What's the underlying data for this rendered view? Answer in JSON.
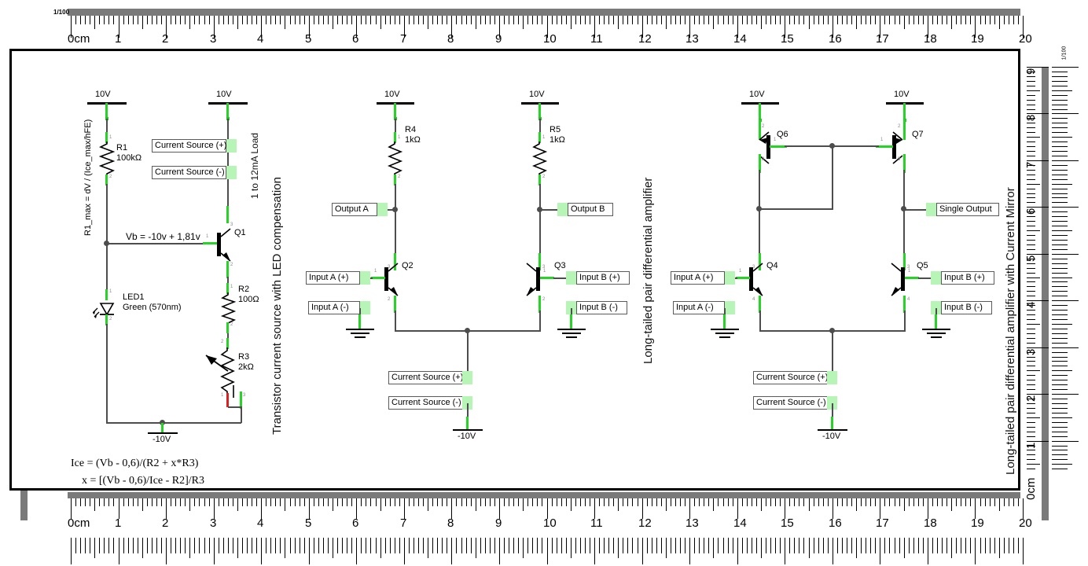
{
  "ruler": {
    "scale_label": "1/100",
    "unit_label": "0cm",
    "h_ticks": [
      "0cm",
      "1",
      "2",
      "3",
      "4",
      "5",
      "6",
      "7",
      "8",
      "9",
      "10",
      "11",
      "12",
      "13",
      "14",
      "15",
      "16",
      "17",
      "18",
      "19",
      "20"
    ],
    "v_ticks": [
      "9",
      "8",
      "7",
      "6",
      "5",
      "4",
      "3",
      "2",
      "1",
      "0cm"
    ]
  },
  "circuits": [
    {
      "title": "Transistor current source with LED compensation",
      "rails": {
        "top_left": "10V",
        "top_right": "10V",
        "bottom": "-10V"
      },
      "components": [
        {
          "ref": "R1",
          "value": "100kΩ"
        },
        {
          "ref": "R2",
          "value": "100Ω"
        },
        {
          "ref": "R3",
          "value": "2kΩ"
        },
        {
          "ref": "LED1",
          "value": "Green (570nm)"
        },
        {
          "ref": "Q1",
          "value": ""
        }
      ],
      "flags": [
        {
          "label": "Current Source (+)"
        },
        {
          "label": "Current Source (-)"
        }
      ],
      "annotations": {
        "r1_max": "R1_max = dV / (Ice_max/hFE)",
        "vb": "Vb = -10v + 1,81v",
        "load": "1 to 12mA Load"
      },
      "formulas": [
        "Ice = (Vb - 0,6)/(R2 + x*R3)",
        "x = [(Vb - 0,6)/Ice - R2]/R3"
      ]
    },
    {
      "title": "Long-tailed pair differential amplifier",
      "rails": {
        "top_left": "10V",
        "top_right": "10V",
        "bottom": "-10V"
      },
      "components": [
        {
          "ref": "R4",
          "value": "1kΩ"
        },
        {
          "ref": "R5",
          "value": "1kΩ"
        },
        {
          "ref": "Q2",
          "value": ""
        },
        {
          "ref": "Q3",
          "value": ""
        }
      ],
      "flags": [
        {
          "label": "Output A"
        },
        {
          "label": "Output B"
        },
        {
          "label": "Input A (+)"
        },
        {
          "label": "Input A (-)"
        },
        {
          "label": "Input B (+)"
        },
        {
          "label": "Input B (-)"
        },
        {
          "label": "Current Source (+)"
        },
        {
          "label": "Current Source (-)"
        }
      ]
    },
    {
      "title": "Long-tailed pair differential amplifier with Current Mirror",
      "rails": {
        "top_left": "10V",
        "top_right": "10V",
        "bottom": "-10V"
      },
      "components": [
        {
          "ref": "Q4",
          "value": ""
        },
        {
          "ref": "Q5",
          "value": ""
        },
        {
          "ref": "Q6",
          "value": ""
        },
        {
          "ref": "Q7",
          "value": ""
        }
      ],
      "flags": [
        {
          "label": "Single Output"
        },
        {
          "label": "Input A (+)"
        },
        {
          "label": "Input A (-)"
        },
        {
          "label": "Input B (+)"
        },
        {
          "label": "Input B (-)"
        },
        {
          "label": "Current Source (+)"
        },
        {
          "label": "Current Source (-)"
        }
      ]
    }
  ],
  "colors": {
    "wire": "#4d4d4d",
    "pin": "#26d426",
    "pin_red": "#e02020",
    "flag_arrow": "#b7f5b7",
    "frame": "#000000",
    "ruler_band": "#7a7a7a"
  }
}
